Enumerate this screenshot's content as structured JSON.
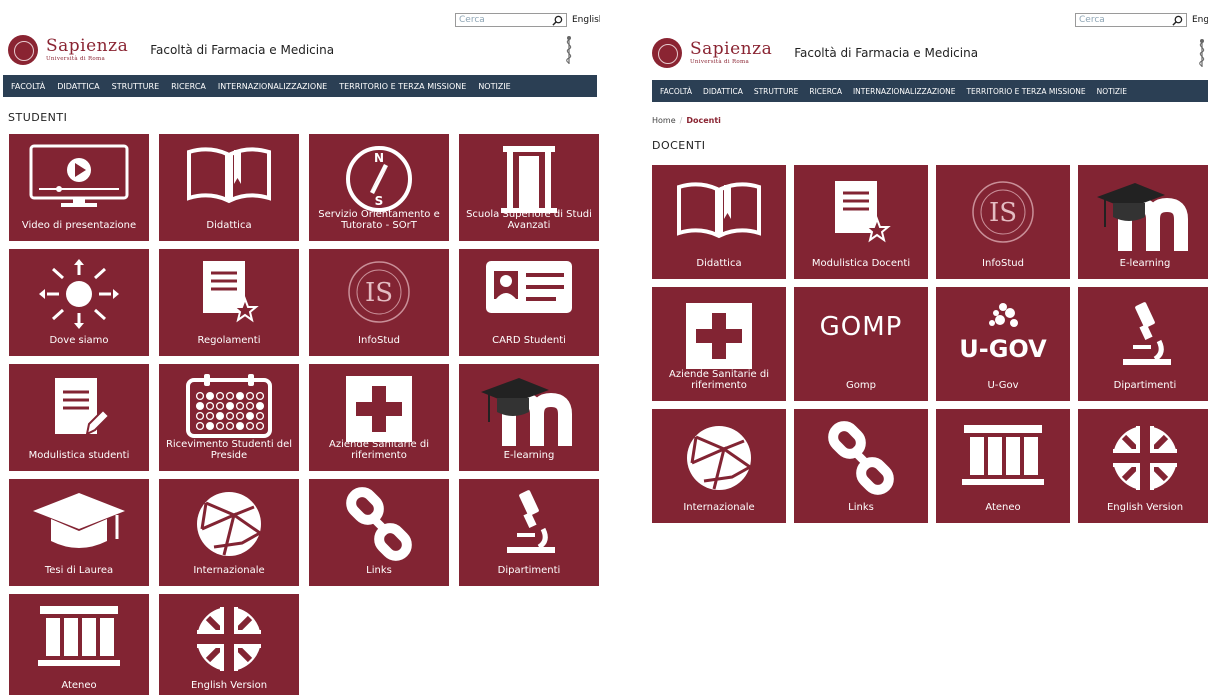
{
  "screens": [
    {
      "search": {
        "placeholder": "Cerca",
        "lang": "English"
      },
      "logo": {
        "name": "Sapienza",
        "sub": "Università di Roma"
      },
      "faculty": "Facoltà di Farmacia e Medicina",
      "nav": [
        "FACOLTÀ",
        "DIDATTICA",
        "STRUTTURE",
        "RICERCA",
        "INTERNAZIONALIZZAZIONE",
        "TERRITORIO E TERZA MISSIONE",
        "NOTIZIE"
      ],
      "breadcrumb": null,
      "section_title": "STUDENTI",
      "tiles": [
        {
          "label": "Video di presentazione",
          "icon": "video-player-icon"
        },
        {
          "label": "Didattica",
          "icon": "open-book-icon"
        },
        {
          "label": "Servizio Orientamento e Tutorato - SOrT",
          "icon": "compass-icon"
        },
        {
          "label": "Scuola Superiore di Studi Avanzati",
          "icon": "door-icon"
        },
        {
          "label": "Dove siamo",
          "icon": "sun-arrows-icon"
        },
        {
          "label": "Regolamenti",
          "icon": "document-star-icon"
        },
        {
          "label": "InfoStud",
          "icon": "infostud-seal-icon"
        },
        {
          "label": "CARD Studenti",
          "icon": "id-card-icon"
        },
        {
          "label": "Modulistica studenti",
          "icon": "document-pencil-icon"
        },
        {
          "label": "Ricevimento Studenti del Preside",
          "icon": "calendar-icon"
        },
        {
          "label": "Aziende Sanitarie di riferimento",
          "icon": "medical-cross-icon"
        },
        {
          "label": "E-learning",
          "icon": "moodle-icon"
        },
        {
          "label": "Tesi di Laurea",
          "icon": "graduation-cap-icon"
        },
        {
          "label": "Internazionale",
          "icon": "network-globe-icon"
        },
        {
          "label": "Links",
          "icon": "chain-link-icon"
        },
        {
          "label": "Dipartimenti",
          "icon": "microscope-icon"
        },
        {
          "label": "Ateneo",
          "icon": "columns-building-icon"
        },
        {
          "label": "English Version",
          "icon": "union-jack-icon"
        }
      ]
    },
    {
      "search": {
        "placeholder": "Cerca",
        "lang": "English"
      },
      "logo": {
        "name": "Sapienza",
        "sub": "Università di Roma"
      },
      "faculty": "Facoltà di Farmacia e Medicina",
      "nav": [
        "FACOLTÀ",
        "DIDATTICA",
        "STRUTTURE",
        "RICERCA",
        "INTERNAZIONALIZZAZIONE",
        "TERRITORIO E TERZA MISSIONE",
        "NOTIZIE"
      ],
      "breadcrumb": {
        "home": "Home",
        "current": "Docenti"
      },
      "section_title": "DOCENTI",
      "tiles": [
        {
          "label": "Didattica",
          "icon": "open-book-icon"
        },
        {
          "label": "Modulistica Docenti",
          "icon": "document-star-icon"
        },
        {
          "label": "InfoStud",
          "icon": "infostud-seal-icon"
        },
        {
          "label": "E-learning",
          "icon": "moodle-icon"
        },
        {
          "label": "Aziende Sanitarie di riferimento",
          "icon": "medical-cross-icon"
        },
        {
          "label": "Gomp",
          "icon": "gomp-logo-icon",
          "logo_text": "GOMP"
        },
        {
          "label": "U-Gov",
          "icon": "ugov-logo-icon",
          "logo_text": "U-GOV"
        },
        {
          "label": "Dipartimenti",
          "icon": "microscope-icon"
        },
        {
          "label": "Internazionale",
          "icon": "network-globe-icon"
        },
        {
          "label": "Links",
          "icon": "chain-link-icon"
        },
        {
          "label": "Ateneo",
          "icon": "columns-building-icon"
        },
        {
          "label": "English Version",
          "icon": "union-jack-icon"
        }
      ]
    }
  ],
  "colors": {
    "tile": "#822433",
    "nav": "#2b3f54",
    "brand": "#8a2432"
  }
}
